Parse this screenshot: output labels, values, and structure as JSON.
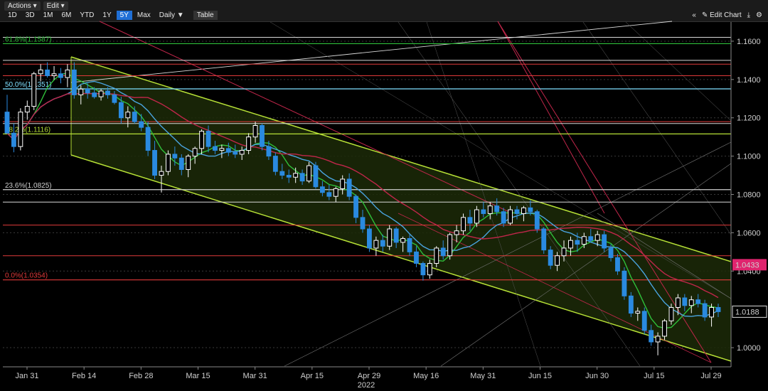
{
  "toolbar": {
    "menus": [
      "Actions ▾",
      "Edit ▾"
    ],
    "ranges": [
      "1D",
      "3D",
      "1M",
      "6M",
      "YTD",
      "1Y",
      "5Y",
      "Max",
      "Daily ▼"
    ],
    "active_range": "5Y",
    "table_label": "Table",
    "collapse_label": "«",
    "edit_chart_label": "✎ Edit Chart",
    "download_label": "⤓",
    "settings_label": "⚙"
  },
  "colors": {
    "background": "#000000",
    "up_candle": "#ffffff",
    "down_candle": "#2a8ae0",
    "channel": "#b6e036",
    "channel_fill": "#1c2a08",
    "ma_fast": "#2fbf3a",
    "ma_mid": "#c0264a",
    "ma_slow": "#4aa4e0",
    "resistance": "#e03a3a",
    "last_price_badge": "#e0246e"
  },
  "chart_data": {
    "type": "candlestick",
    "xlabel": "2022",
    "ylim": [
      0.99,
      1.17
    ],
    "x_ticks": [
      "Jan 31",
      "Feb 14",
      "Feb 28",
      "Mar 15",
      "Mar 31",
      "Apr 15",
      "Apr 29",
      "May 16",
      "May 31",
      "Jun 15",
      "Jun 30",
      "Jul 15",
      "Jul 29"
    ],
    "y_ticks": [
      "1.1600",
      "1.1400",
      "1.1200",
      "1.1000",
      "1.0800",
      "1.0600",
      "1.0400",
      "1.0000"
    ],
    "y_tick_values": [
      1.16,
      1.14,
      1.12,
      1.1,
      1.08,
      1.06,
      1.04,
      1.0
    ],
    "price_badges": [
      {
        "label": "1.0433",
        "value": 1.0433,
        "style": "magenta"
      },
      {
        "label": "1.0188",
        "value": 1.0188,
        "style": "white"
      }
    ],
    "fib_levels": [
      {
        "label": "61.8%(1.1587)",
        "value": 1.1587,
        "color": "#2fbf3a"
      },
      {
        "label": "50.0%(1.1351)",
        "value": 1.1351,
        "color": "#7fe0ff"
      },
      {
        "label": "38.2%(1.1116)",
        "value": 1.1116,
        "color": "#b6e036"
      },
      {
        "label": "23.6%(1.0825)",
        "value": 1.0825,
        "color": "#cfcfcf"
      },
      {
        "label": "0.0%(1.0354)",
        "value": 1.0354,
        "color": "#e03a3a"
      }
    ],
    "candles": [
      [
        1.123,
        1.132,
        1.114,
        1.112
      ],
      [
        1.112,
        1.117,
        1.102,
        1.105
      ],
      [
        1.105,
        1.125,
        1.103,
        1.123
      ],
      [
        1.123,
        1.129,
        1.119,
        1.126
      ],
      [
        1.126,
        1.144,
        1.124,
        1.143
      ],
      [
        1.143,
        1.148,
        1.139,
        1.145
      ],
      [
        1.145,
        1.149,
        1.141,
        1.142
      ],
      [
        1.142,
        1.147,
        1.14,
        1.143
      ],
      [
        1.143,
        1.146,
        1.138,
        1.141
      ],
      [
        1.141,
        1.148,
        1.136,
        1.145
      ],
      [
        1.145,
        1.149,
        1.13,
        1.132
      ],
      [
        1.132,
        1.137,
        1.127,
        1.135
      ],
      [
        1.135,
        1.138,
        1.13,
        1.133
      ],
      [
        1.133,
        1.136,
        1.13,
        1.131
      ],
      [
        1.131,
        1.135,
        1.129,
        1.134
      ],
      [
        1.134,
        1.136,
        1.13,
        1.132
      ],
      [
        1.132,
        1.134,
        1.127,
        1.128
      ],
      [
        1.128,
        1.131,
        1.117,
        1.12
      ],
      [
        1.12,
        1.126,
        1.115,
        1.123
      ],
      [
        1.123,
        1.126,
        1.117,
        1.118
      ],
      [
        1.118,
        1.122,
        1.113,
        1.115
      ],
      [
        1.115,
        1.118,
        1.1,
        1.103
      ],
      [
        1.103,
        1.108,
        1.088,
        1.09
      ],
      [
        1.09,
        1.095,
        1.081,
        1.092
      ],
      [
        1.092,
        1.103,
        1.09,
        1.101
      ],
      [
        1.101,
        1.105,
        1.095,
        1.099
      ],
      [
        1.099,
        1.101,
        1.09,
        1.093
      ],
      [
        1.093,
        1.101,
        1.089,
        1.1
      ],
      [
        1.1,
        1.105,
        1.096,
        1.104
      ],
      [
        1.104,
        1.114,
        1.101,
        1.113
      ],
      [
        1.113,
        1.116,
        1.102,
        1.105
      ],
      [
        1.105,
        1.108,
        1.101,
        1.103
      ],
      [
        1.103,
        1.106,
        1.099,
        1.104
      ],
      [
        1.104,
        1.107,
        1.1,
        1.102
      ],
      [
        1.102,
        1.106,
        1.099,
        1.101
      ],
      [
        1.101,
        1.105,
        1.098,
        1.103
      ],
      [
        1.103,
        1.112,
        1.101,
        1.11
      ],
      [
        1.11,
        1.118,
        1.107,
        1.116
      ],
      [
        1.116,
        1.117,
        1.103,
        1.105
      ],
      [
        1.105,
        1.108,
        1.098,
        1.1
      ],
      [
        1.1,
        1.102,
        1.09,
        1.092
      ],
      [
        1.092,
        1.096,
        1.088,
        1.09
      ],
      [
        1.09,
        1.093,
        1.086,
        1.089
      ],
      [
        1.089,
        1.094,
        1.086,
        1.091
      ],
      [
        1.091,
        1.093,
        1.085,
        1.087
      ],
      [
        1.087,
        1.097,
        1.086,
        1.095
      ],
      [
        1.095,
        1.097,
        1.083,
        1.084
      ],
      [
        1.084,
        1.087,
        1.079,
        1.081
      ],
      [
        1.081,
        1.085,
        1.077,
        1.079
      ],
      [
        1.079,
        1.084,
        1.076,
        1.083
      ],
      [
        1.083,
        1.09,
        1.08,
        1.088
      ],
      [
        1.088,
        1.091,
        1.077,
        1.079
      ],
      [
        1.079,
        1.08,
        1.065,
        1.068
      ],
      [
        1.068,
        1.072,
        1.06,
        1.062
      ],
      [
        1.062,
        1.064,
        1.05,
        1.052
      ],
      [
        1.052,
        1.058,
        1.048,
        1.056
      ],
      [
        1.056,
        1.059,
        1.05,
        1.053
      ],
      [
        1.053,
        1.064,
        1.051,
        1.062
      ],
      [
        1.062,
        1.063,
        1.052,
        1.055
      ],
      [
        1.055,
        1.058,
        1.05,
        1.057
      ],
      [
        1.057,
        1.059,
        1.048,
        1.05
      ],
      [
        1.05,
        1.053,
        1.042,
        1.044
      ],
      [
        1.044,
        1.045,
        1.035,
        1.038
      ],
      [
        1.038,
        1.046,
        1.036,
        1.044
      ],
      [
        1.044,
        1.053,
        1.042,
        1.052
      ],
      [
        1.052,
        1.056,
        1.046,
        1.048
      ],
      [
        1.048,
        1.06,
        1.046,
        1.059
      ],
      [
        1.059,
        1.064,
        1.055,
        1.061
      ],
      [
        1.061,
        1.07,
        1.059,
        1.068
      ],
      [
        1.068,
        1.072,
        1.061,
        1.065
      ],
      [
        1.065,
        1.074,
        1.063,
        1.072
      ],
      [
        1.072,
        1.076,
        1.068,
        1.07
      ],
      [
        1.07,
        1.076,
        1.067,
        1.074
      ],
      [
        1.074,
        1.078,
        1.069,
        1.071
      ],
      [
        1.071,
        1.073,
        1.063,
        1.065
      ],
      [
        1.065,
        1.074,
        1.064,
        1.072
      ],
      [
        1.072,
        1.074,
        1.067,
        1.07
      ],
      [
        1.07,
        1.074,
        1.066,
        1.073
      ],
      [
        1.073,
        1.077,
        1.069,
        1.071
      ],
      [
        1.071,
        1.072,
        1.06,
        1.062
      ],
      [
        1.062,
        1.063,
        1.049,
        1.051
      ],
      [
        1.051,
        1.053,
        1.041,
        1.043
      ],
      [
        1.043,
        1.05,
        1.04,
        1.048
      ],
      [
        1.048,
        1.056,
        1.045,
        1.052
      ],
      [
        1.052,
        1.058,
        1.048,
        1.056
      ],
      [
        1.056,
        1.06,
        1.05,
        1.054
      ],
      [
        1.054,
        1.06,
        1.052,
        1.058
      ],
      [
        1.058,
        1.062,
        1.055,
        1.056
      ],
      [
        1.056,
        1.061,
        1.053,
        1.059
      ],
      [
        1.059,
        1.061,
        1.05,
        1.052
      ],
      [
        1.052,
        1.054,
        1.045,
        1.047
      ],
      [
        1.047,
        1.049,
        1.038,
        1.04
      ],
      [
        1.04,
        1.042,
        1.025,
        1.027
      ],
      [
        1.027,
        1.029,
        1.016,
        1.018
      ],
      [
        1.018,
        1.021,
        1.014,
        1.019
      ],
      [
        1.019,
        1.021,
        1.007,
        1.009
      ],
      [
        1.009,
        1.012,
        1.001,
        1.003
      ],
      [
        1.003,
        1.008,
        0.996,
        1.006
      ],
      [
        1.006,
        1.015,
        1.004,
        1.014
      ],
      [
        1.014,
        1.023,
        1.012,
        1.021
      ],
      [
        1.021,
        1.028,
        1.017,
        1.026
      ],
      [
        1.026,
        1.028,
        1.019,
        1.022
      ],
      [
        1.022,
        1.027,
        1.018,
        1.025
      ],
      [
        1.025,
        1.028,
        1.021,
        1.023
      ],
      [
        1.023,
        1.025,
        1.014,
        1.016
      ],
      [
        1.016,
        1.023,
        1.011,
        1.021
      ],
      [
        1.021,
        1.023,
        1.016,
        1.0188
      ]
    ]
  }
}
